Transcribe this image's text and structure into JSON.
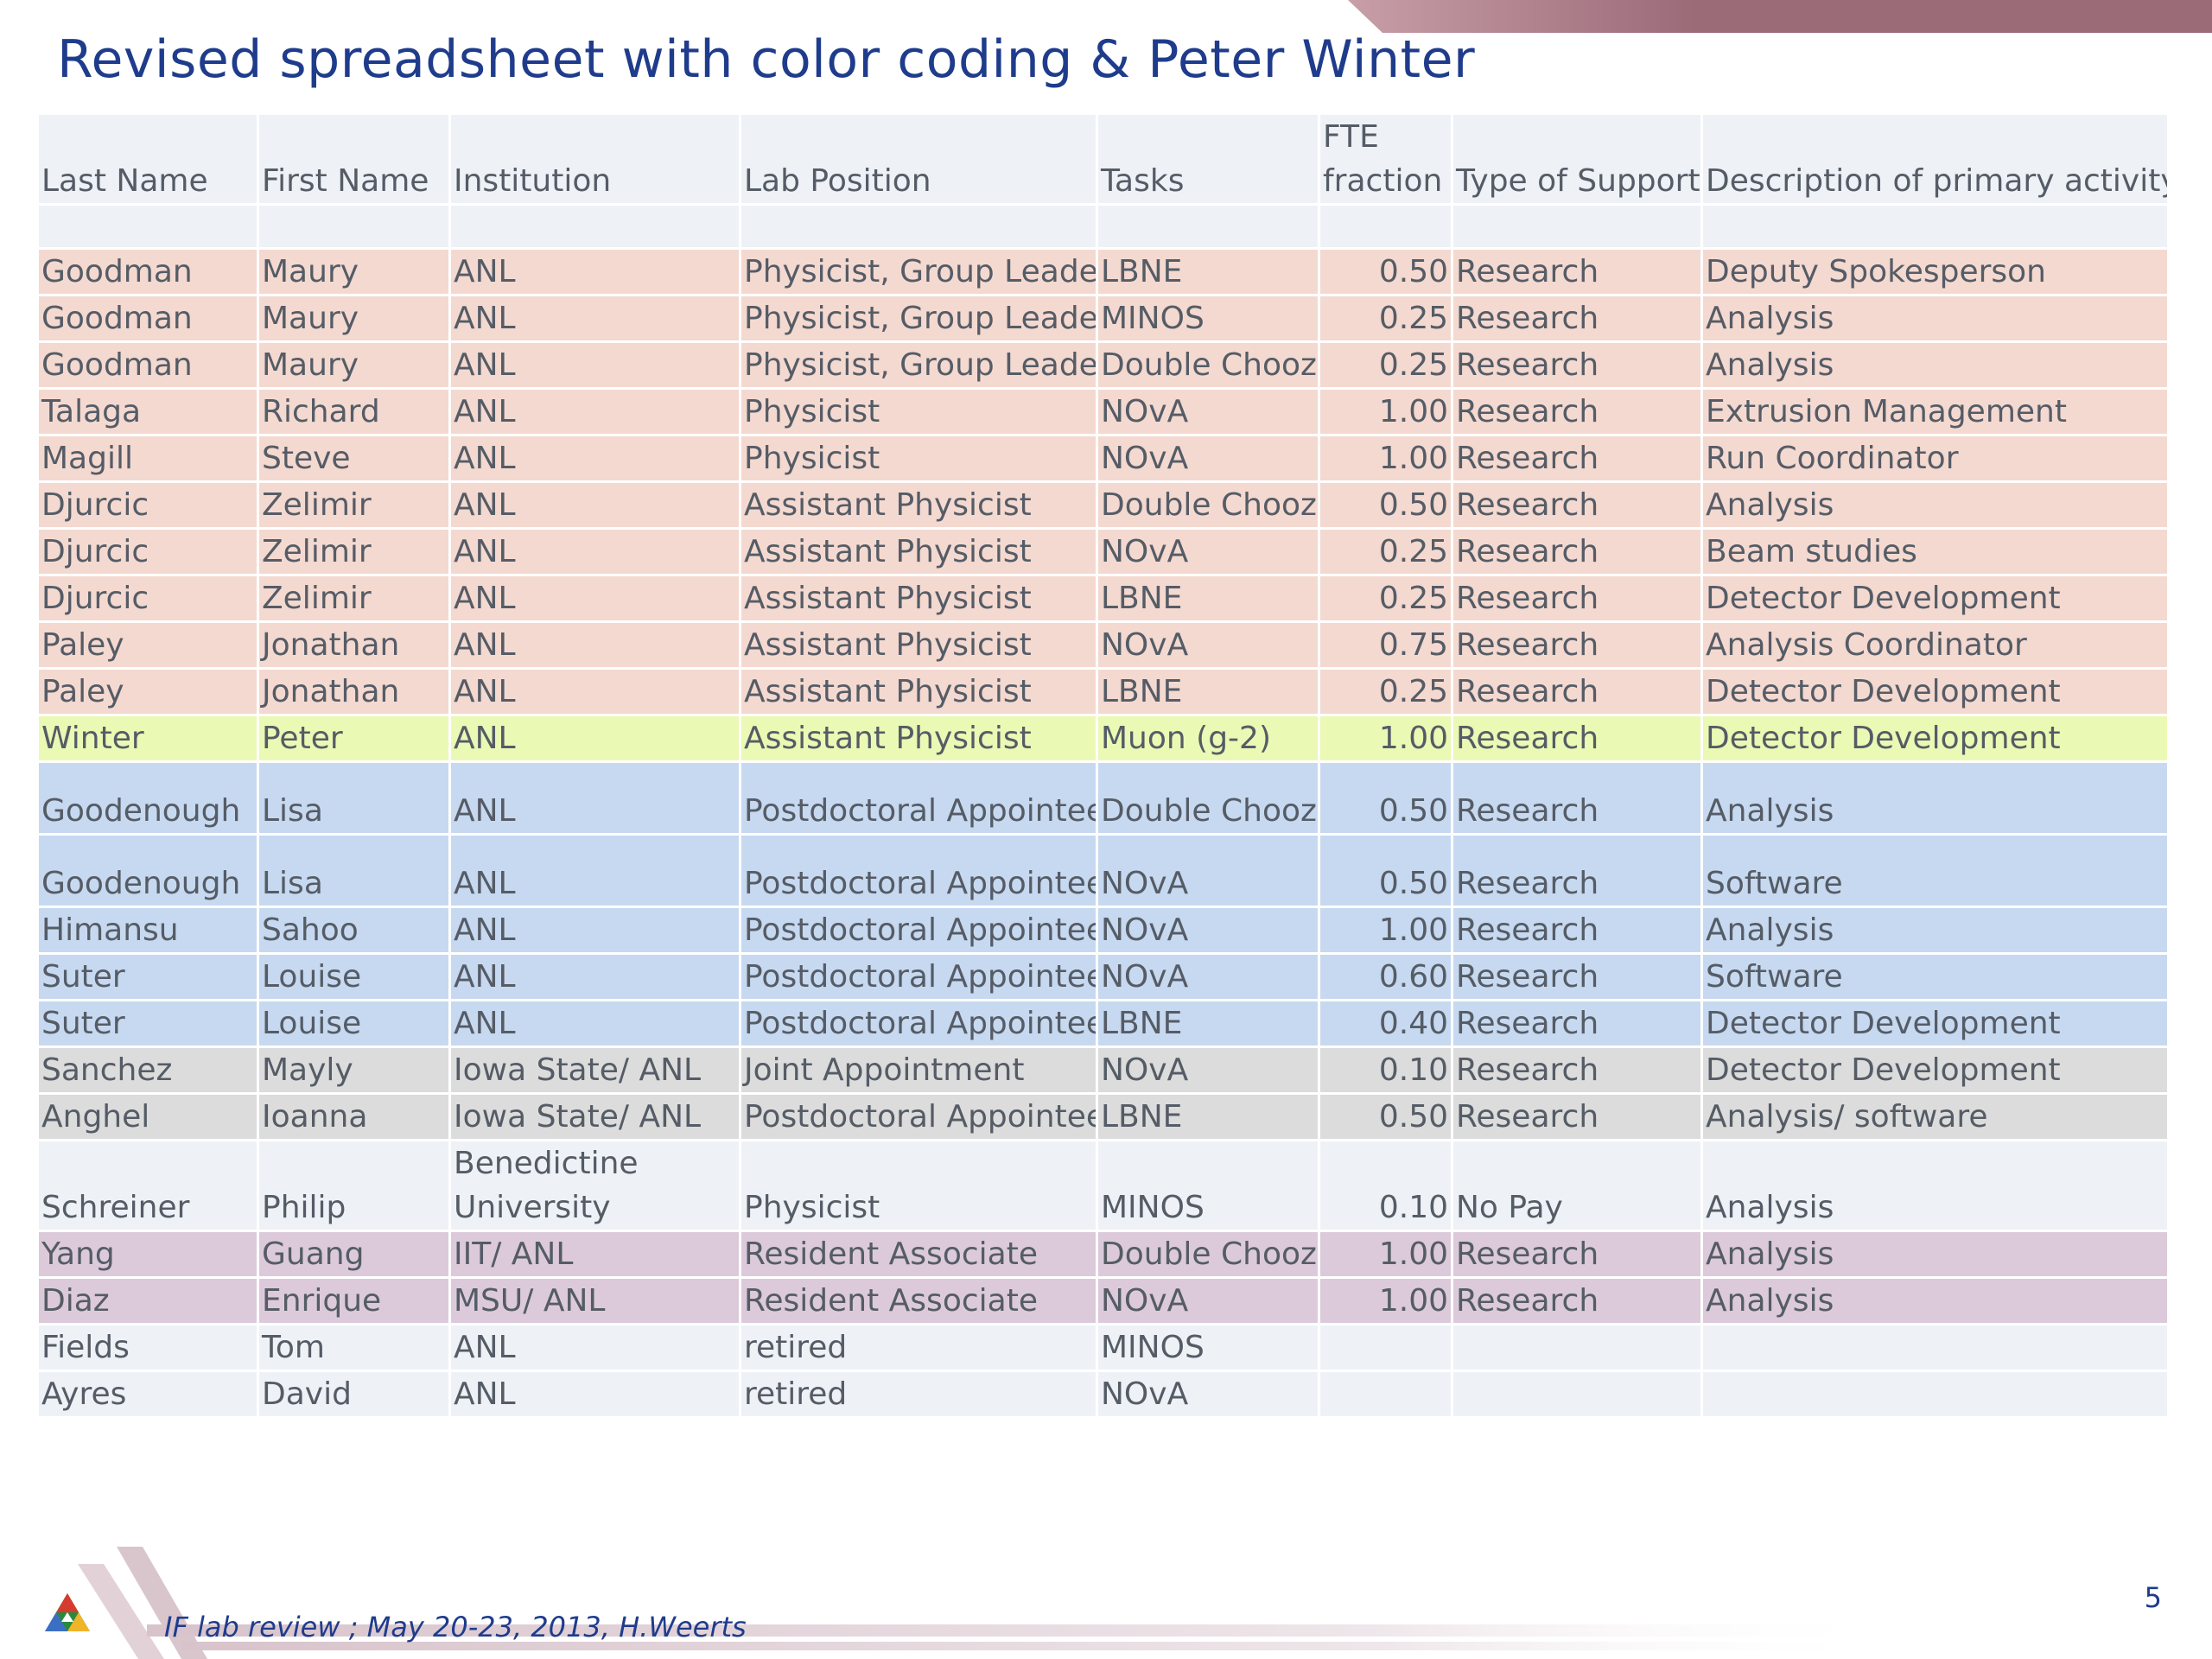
{
  "title": "Revised spreadsheet with color coding & Peter Winter",
  "colors": {
    "title": "#1f3c8c",
    "pink": "#f4d9d0",
    "lime": "#eaf9b4",
    "blue": "#c7d9f0",
    "gray": "#dcdcdc",
    "light": "#eef2f7",
    "mauve": "#dccadb",
    "top_band": "#9b6b78"
  },
  "table": {
    "headers": {
      "last": "Last Name",
      "first": "First Name",
      "inst": "Institution",
      "pos": "Lab Position",
      "tasks": "Tasks",
      "fte_line1": "FTE",
      "fte_line2": "fraction",
      "support": "Type of Support",
      "desc": "Description of primary activity"
    },
    "rows": [
      {
        "last": "Goodman",
        "first": "Maury",
        "inst": "ANL",
        "pos": "Physicist, Group Leader",
        "task": "LBNE",
        "fte": "0.50",
        "support": "Research",
        "desc": "Deputy Spokesperson",
        "color": "pink"
      },
      {
        "last": "Goodman",
        "first": "Maury",
        "inst": "ANL",
        "pos": "Physicist, Group Leader",
        "task": "MINOS",
        "fte": "0.25",
        "support": "Research",
        "desc": "Analysis",
        "color": "pink"
      },
      {
        "last": "Goodman",
        "first": "Maury",
        "inst": "ANL",
        "pos": "Physicist, Group Leader",
        "task": "Double Chooz",
        "fte": "0.25",
        "support": "Research",
        "desc": "Analysis",
        "color": "pink"
      },
      {
        "last": "Talaga",
        "first": "Richard",
        "inst": "ANL",
        "pos": "Physicist",
        "task": "NOvA",
        "fte": "1.00",
        "support": "Research",
        "desc": "Extrusion Management",
        "color": "pink"
      },
      {
        "last": "Magill",
        "first": "Steve",
        "inst": "ANL",
        "pos": "Physicist",
        "task": "NOvA",
        "fte": "1.00",
        "support": "Research",
        "desc": "Run Coordinator",
        "color": "pink"
      },
      {
        "last": "Djurcic",
        "first": "Zelimir",
        "inst": "ANL",
        "pos": "Assistant Physicist",
        "task": "Double Chooz",
        "fte": "0.50",
        "support": "Research",
        "desc": "Analysis",
        "color": "pink"
      },
      {
        "last": "Djurcic",
        "first": "Zelimir",
        "inst": "ANL",
        "pos": "Assistant Physicist",
        "task": "NOvA",
        "fte": "0.25",
        "support": "Research",
        "desc": "Beam studies",
        "color": "pink"
      },
      {
        "last": "Djurcic",
        "first": "Zelimir",
        "inst": "ANL",
        "pos": "Assistant Physicist",
        "task": "LBNE",
        "fte": "0.25",
        "support": "Research",
        "desc": "Detector Development",
        "color": "pink"
      },
      {
        "last": "Paley",
        "first": "Jonathan",
        "inst": "ANL",
        "pos": "Assistant Physicist",
        "task": "NOvA",
        "fte": "0.75",
        "support": "Research",
        "desc": "Analysis Coordinator",
        "color": "pink"
      },
      {
        "last": "Paley",
        "first": "Jonathan",
        "inst": "ANL",
        "pos": "Assistant Physicist",
        "task": "LBNE",
        "fte": "0.25",
        "support": "Research",
        "desc": "Detector Development",
        "color": "pink"
      },
      {
        "last": "Winter",
        "first": "Peter",
        "inst": "ANL",
        "pos": "Assistant Physicist",
        "task": "Muon (g-2)",
        "fte": "1.00",
        "support": "Research",
        "desc": "Detector Development",
        "color": "lime"
      },
      {
        "last": "Goodenough",
        "first": "Lisa",
        "inst": "ANL",
        "pos": "Postdoctoral Appointee",
        "task": "Double Chooz",
        "fte": "0.50",
        "support": "Research",
        "desc": "Analysis",
        "color": "blue",
        "tall": true
      },
      {
        "last": "Goodenough",
        "first": "Lisa",
        "inst": "ANL",
        "pos": "Postdoctoral Appointee",
        "task": "NOvA",
        "fte": "0.50",
        "support": "Research",
        "desc": "Software",
        "color": "blue",
        "tall": true
      },
      {
        "last": "Himansu",
        "first": "Sahoo",
        "inst": "ANL",
        "pos": "Postdoctoral Appointee",
        "task": "NOvA",
        "fte": "1.00",
        "support": "Research",
        "desc": "Analysis",
        "color": "blue"
      },
      {
        "last": "Suter",
        "first": "Louise",
        "inst": "ANL",
        "pos": "Postdoctoral Appointee",
        "task": "NOvA",
        "fte": "0.60",
        "support": "Research",
        "desc": "Software",
        "color": "blue"
      },
      {
        "last": "Suter",
        "first": "Louise",
        "inst": "ANL",
        "pos": "Postdoctoral Appointee",
        "task": "LBNE",
        "fte": "0.40",
        "support": "Research",
        "desc": "Detector Development",
        "color": "blue"
      },
      {
        "last": "Sanchez",
        "first": "Mayly",
        "inst": "Iowa State/ ANL",
        "pos": "Joint Appointment",
        "task": "NOvA",
        "fte": "0.10",
        "support": "Research",
        "desc": "Detector Development",
        "color": "gray"
      },
      {
        "last": "Anghel",
        "first": "Ioanna",
        "inst": "Iowa State/ ANL",
        "pos": "Postdoctoral Appointee",
        "task": "LBNE",
        "fte": "0.50",
        "support": "Research",
        "desc": "Analysis/ software",
        "color": "gray"
      },
      {
        "last": "Schreiner",
        "first": "Philip",
        "inst_line1": "Benedictine",
        "inst": "University",
        "pos": "Physicist",
        "task": "MINOS",
        "fte": "0.10",
        "support": "No Pay",
        "desc": "Analysis",
        "color": "light",
        "wrap2": true
      },
      {
        "last": "Yang",
        "first": "Guang",
        "inst": "IIT/ ANL",
        "pos": "Resident Associate",
        "task": "Double Chooz",
        "fte": "1.00",
        "support": "Research",
        "desc": "Analysis",
        "color": "mauve"
      },
      {
        "last": "Diaz",
        "first": "Enrique",
        "inst": "MSU/ ANL",
        "pos": "Resident Associate",
        "task": "NOvA",
        "fte": "1.00",
        "support": "Research",
        "desc": "Analysis",
        "color": "mauve"
      },
      {
        "last": "Fields",
        "first": "Tom",
        "inst": "ANL",
        "pos": "retired",
        "task": "MINOS",
        "fte": "",
        "support": "",
        "desc": "",
        "color": "light"
      },
      {
        "last": "Ayres",
        "first": "David",
        "inst": "ANL",
        "pos": "retired",
        "task": "NOvA",
        "fte": "",
        "support": "",
        "desc": "",
        "color": "light"
      }
    ]
  },
  "footer": {
    "text": "IF lab review ; May 20-23, 2013, H.Weerts",
    "page_number": "5",
    "logo_icon": "argonne-triangle-logo"
  }
}
